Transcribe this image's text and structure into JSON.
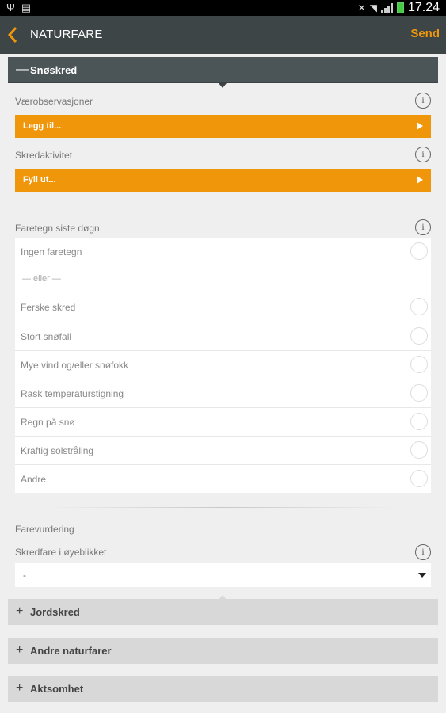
{
  "statusbar": {
    "time": "17.24"
  },
  "actionbar": {
    "title": "NATURFARE",
    "send_label": "Send"
  },
  "sections": {
    "snoskred": {
      "sign": "—",
      "label": "Snøskred"
    },
    "jordskred": {
      "sign": "+",
      "label": "Jordskred"
    },
    "andre": {
      "sign": "+",
      "label": "Andre naturfarer"
    },
    "aktsomhet": {
      "sign": "+",
      "label": "Aktsomhet"
    }
  },
  "weather": {
    "label": "Værobservasjoner",
    "button": "Legg til..."
  },
  "avalanche_activity": {
    "label": "Skredaktivitet",
    "button": "Fyll ut..."
  },
  "signs": {
    "label": "Faretegn siste døgn",
    "none": "Ingen faretegn",
    "or_text": "— eller —",
    "items": [
      "Ferske skred",
      "Stort snøfall",
      "Mye vind og/eller snøfokk",
      "Rask temperaturstigning",
      "Regn på snø",
      "Kraftig solstråling",
      "Andre"
    ]
  },
  "assessment": {
    "label": "Farevurdering",
    "danger_label": "Skredfare i øyeblikket",
    "danger_value": "-"
  },
  "info_icon": "i",
  "colors": {
    "accent": "#f0960a",
    "bar": "#3d4547",
    "section_open": "#4b5457"
  }
}
